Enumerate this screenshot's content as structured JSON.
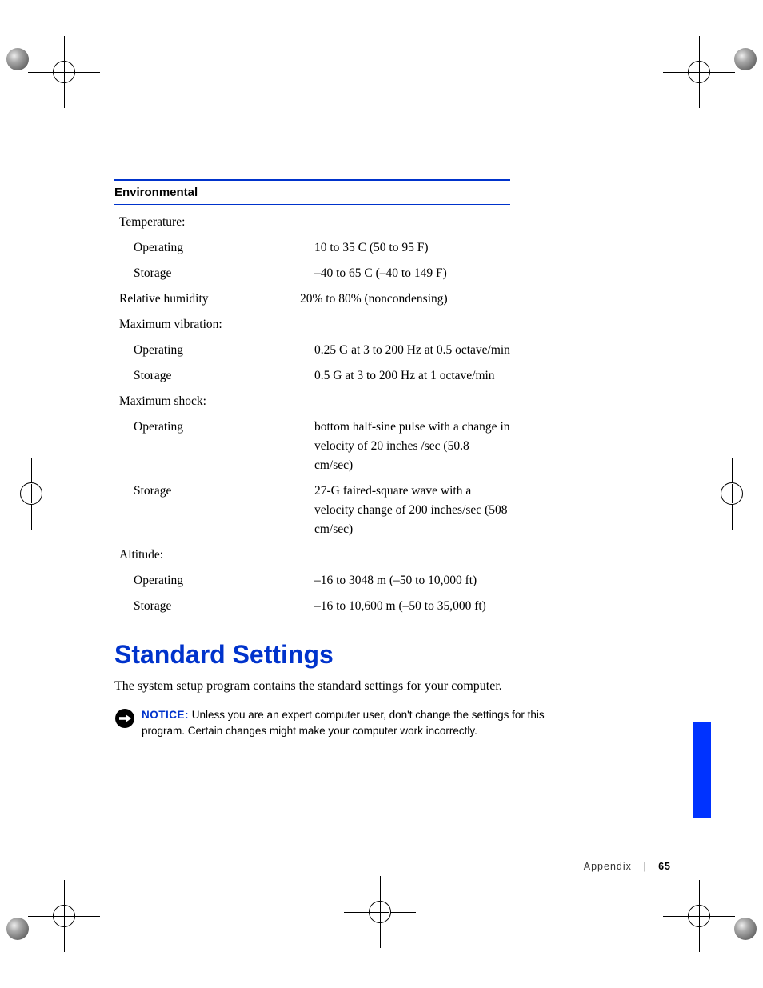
{
  "section_header": "Environmental",
  "specs": [
    {
      "label": "Temperature:",
      "value": "",
      "indent": false
    },
    {
      "label": "Operating",
      "value": "10  to 35 C (50  to 95 F)",
      "indent": true
    },
    {
      "label": "Storage",
      "value": "–40  to 65 C (–40  to 149 F)",
      "indent": true
    },
    {
      "label": "Relative humidity",
      "value": "20% to 80% (noncondensing)",
      "indent": false
    },
    {
      "label": "Maximum vibration:",
      "value": "",
      "indent": false
    },
    {
      "label": "Operating",
      "value": "0.25 G at 3 to 200 Hz at 0.5 octave/min",
      "indent": true
    },
    {
      "label": "Storage",
      "value": "0.5 G at 3 to 200 Hz at 1 octave/min",
      "indent": true
    },
    {
      "label": "Maximum shock:",
      "value": "",
      "indent": false
    },
    {
      "label": "Operating",
      "value": "bottom half-sine pulse with a change in velocity of 20 inches /sec (50.8 cm/sec)",
      "indent": true
    },
    {
      "label": "Storage",
      "value": "27-G faired-square wave with a velocity change of 200 inches/sec (508 cm/sec)",
      "indent": true
    },
    {
      "label": "Altitude:",
      "value": "",
      "indent": false
    },
    {
      "label": "Operating",
      "value": "–16 to 3048 m (–50 to 10,000 ft)",
      "indent": true
    },
    {
      "label": "Storage",
      "value": "–16 to 10,600 m (–50 to 35,000 ft)",
      "indent": true
    }
  ],
  "heading": "Standard Settings",
  "paragraph": "The system setup program contains the standard settings for your computer.",
  "notice": {
    "label": "NOTICE:",
    "text": "Unless you are an expert computer user, don't change the settings for this program. Certain changes might make your computer work incorrectly."
  },
  "footer": {
    "section": "Appendix",
    "page": "65"
  }
}
